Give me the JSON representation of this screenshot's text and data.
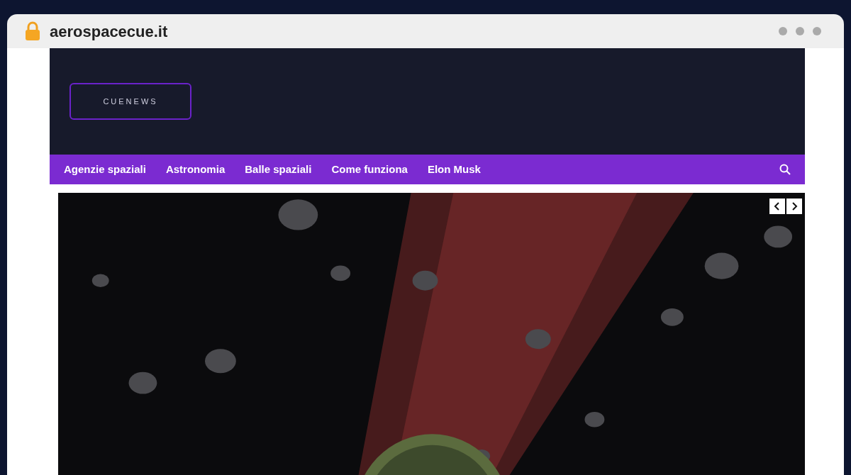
{
  "address_bar": {
    "url": "aerospacecue.it"
  },
  "header": {
    "logo_text": "CUENEWS"
  },
  "nav": {
    "items": [
      {
        "label": "Agenzie spaziali"
      },
      {
        "label": "Astronomia"
      },
      {
        "label": "Balle spaziali"
      },
      {
        "label": "Come funziona"
      },
      {
        "label": "Elon Musk"
      }
    ]
  }
}
